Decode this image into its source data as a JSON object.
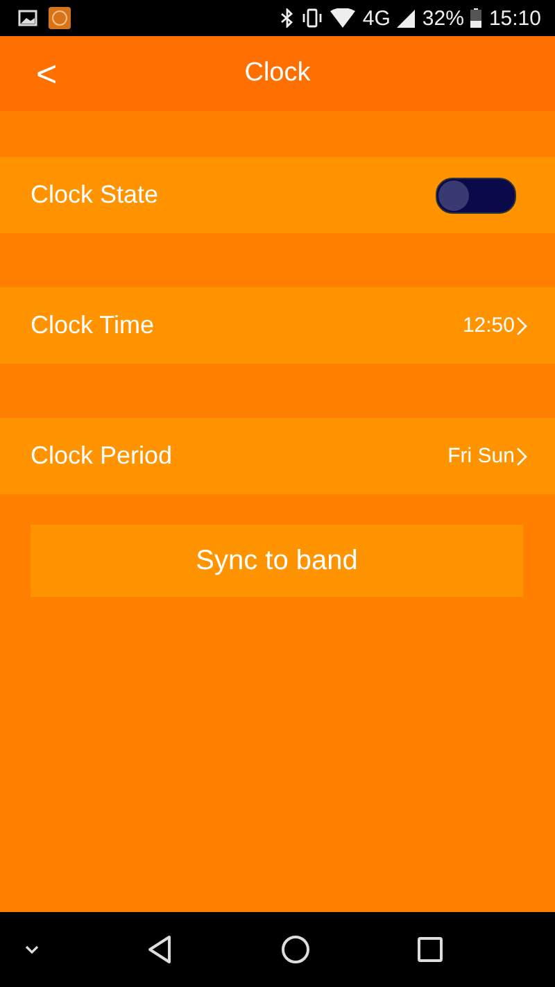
{
  "status_bar": {
    "battery": "32%",
    "network": "4G",
    "time": "15:10"
  },
  "app_bar": {
    "back": "<",
    "title": "Clock"
  },
  "rows": [
    {
      "kind": "toggle",
      "label": "Clock State",
      "on": false
    },
    {
      "kind": "value",
      "label": "Clock Time",
      "value": "12:50"
    },
    {
      "kind": "value",
      "label": "Clock Period",
      "value": "Fri Sun"
    }
  ],
  "sync_button": "Sync to band"
}
